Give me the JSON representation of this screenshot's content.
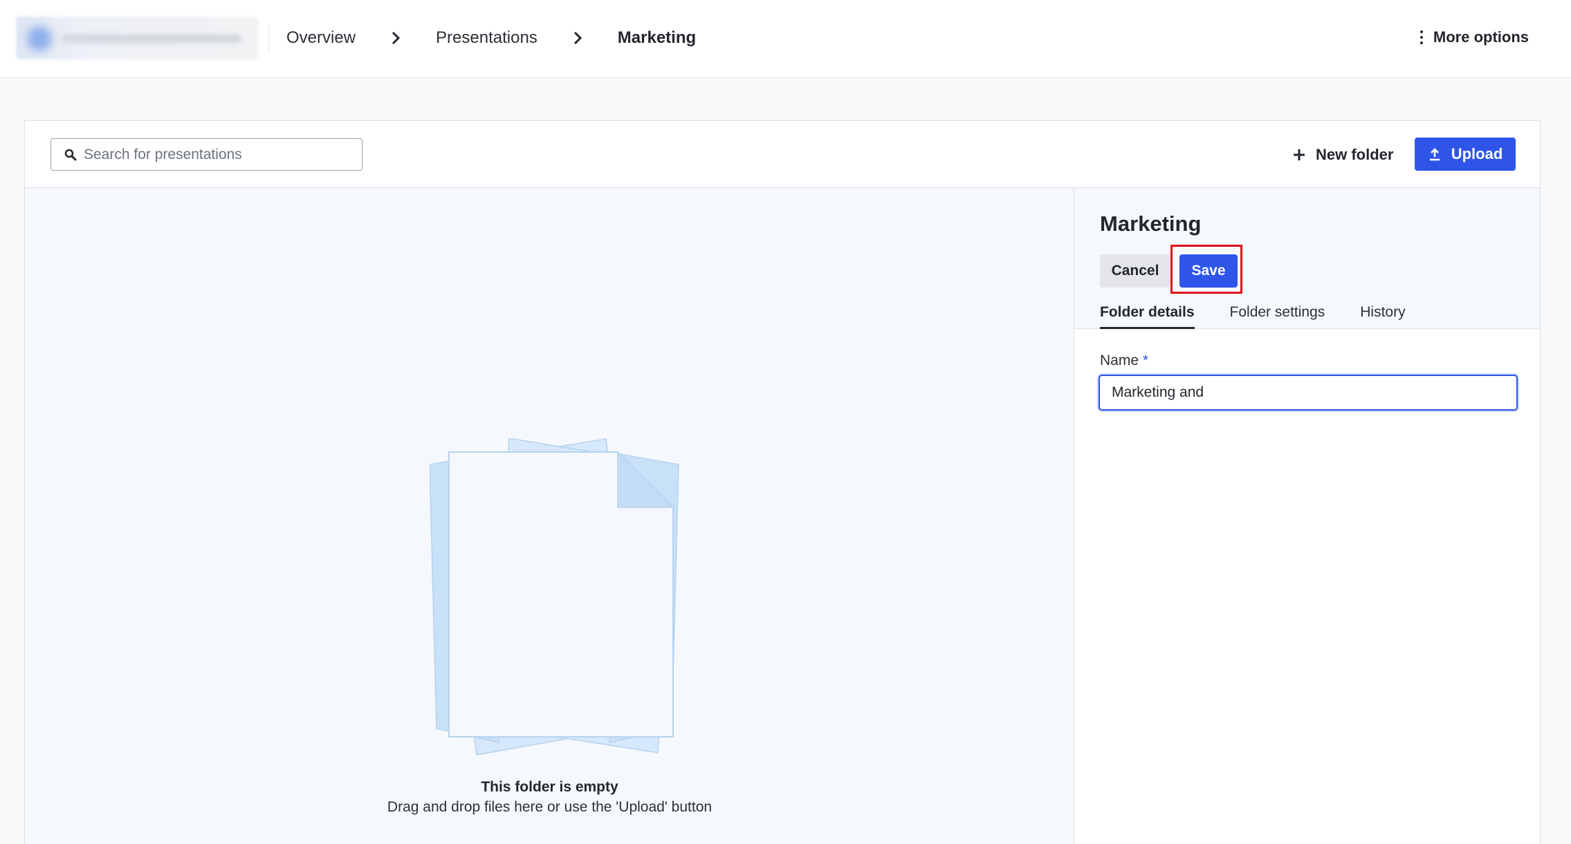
{
  "header": {
    "breadcrumb": [
      {
        "label": "Overview"
      },
      {
        "label": "Presentations"
      },
      {
        "label": "Marketing"
      }
    ],
    "more_options_label": "More options"
  },
  "toolbar": {
    "search_placeholder": "Search for presentations",
    "new_folder_label": "New folder",
    "upload_label": "Upload"
  },
  "empty_state": {
    "title": "This folder is empty",
    "subtitle": "Drag and drop files here or use the 'Upload' button"
  },
  "panel": {
    "title": "Marketing",
    "cancel_label": "Cancel",
    "save_label": "Save",
    "tabs": [
      {
        "label": "Folder details",
        "active": true
      },
      {
        "label": "Folder settings",
        "active": false
      },
      {
        "label": "History",
        "active": false
      }
    ],
    "name_field": {
      "label": "Name",
      "required_mark": "*",
      "value": "Marketing and"
    }
  },
  "colors": {
    "primary": "#2f55e8",
    "highlight": "#e3121d",
    "content_bg": "#f5f8fc"
  },
  "icons": [
    "search-icon",
    "plus-icon",
    "upload-icon",
    "kebab-icon",
    "chevron-right-icon",
    "empty-documents-illustration"
  ]
}
